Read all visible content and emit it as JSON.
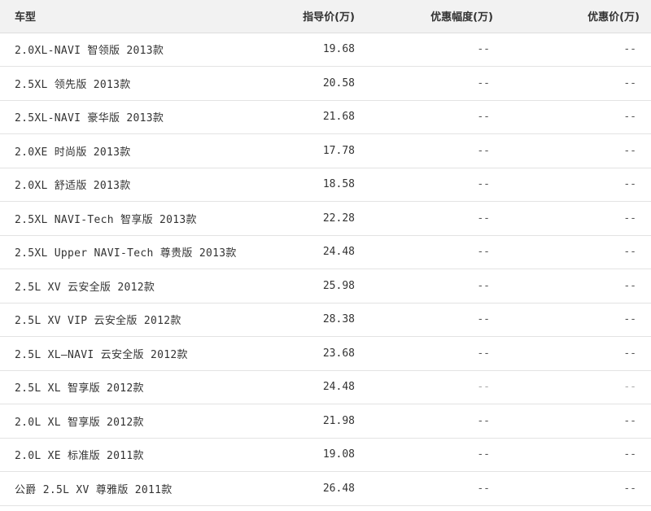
{
  "table": {
    "headers": {
      "model": "车型",
      "msrp": "指导价(万)",
      "discount": "优惠幅度(万)",
      "final": "优惠价(万)"
    },
    "rows": [
      {
        "model": "2.0XL-NAVI 智领版 2013款",
        "msrp": "19.68",
        "discount": "--",
        "final": "--"
      },
      {
        "model": "2.5XL 领先版 2013款",
        "msrp": "20.58",
        "discount": "--",
        "final": "--"
      },
      {
        "model": "2.5XL-NAVI 豪华版 2013款",
        "msrp": "21.68",
        "discount": "--",
        "final": "--"
      },
      {
        "model": "2.0XE 时尚版 2013款",
        "msrp": "17.78",
        "discount": "--",
        "final": "--"
      },
      {
        "model": "2.0XL 舒适版 2013款",
        "msrp": "18.58",
        "discount": "--",
        "final": "--"
      },
      {
        "model": "2.5XL NAVI-Tech 智享版 2013款",
        "msrp": "22.28",
        "discount": "--",
        "final": "--"
      },
      {
        "model": "2.5XL Upper NAVI-Tech 尊贵版 2013款",
        "msrp": "24.48",
        "discount": "--",
        "final": "--"
      },
      {
        "model": "2.5L XV 云安全版 2012款",
        "msrp": "25.98",
        "discount": "--",
        "final": "--"
      },
      {
        "model": "2.5L XV VIP 云安全版 2012款",
        "msrp": "28.38",
        "discount": "--",
        "final": "--"
      },
      {
        "model": "2.5L XL—NAVI 云安全版 2012款",
        "msrp": "23.68",
        "discount": "--",
        "final": "--"
      },
      {
        "model": "2.5L XL 智享版 2012款",
        "msrp": "24.48",
        "discount": "--",
        "final": "--"
      },
      {
        "model": "2.0L XL 智享版 2012款",
        "msrp": "21.98",
        "discount": "--",
        "final": "--"
      },
      {
        "model": "2.0L XE 标准版 2011款",
        "msrp": "19.08",
        "discount": "--",
        "final": "--"
      },
      {
        "model": "公爵 2.5L XV 尊雅版 2011款",
        "msrp": "26.48",
        "discount": "--",
        "final": "--"
      }
    ]
  },
  "colors": {
    "header_background": "#f2f2f2",
    "row_border": "#e3e3e3",
    "text": "#333333"
  }
}
